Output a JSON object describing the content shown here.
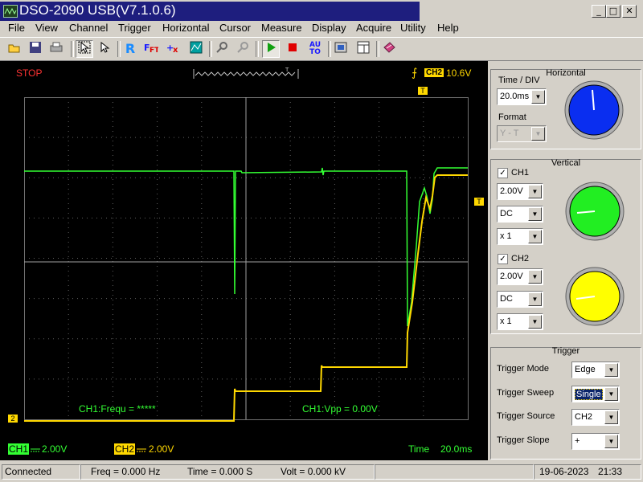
{
  "window": {
    "title": "DSO-2090 USB(V7.1.0.6)",
    "controls": [
      "_",
      "□",
      "✕"
    ]
  },
  "menu": [
    "File",
    "View",
    "Channel",
    "Trigger",
    "Horizontal",
    "Cursor",
    "Measure",
    "Display",
    "Acquire",
    "Utility",
    "Help"
  ],
  "toolbar": {
    "icons": [
      "open-icon",
      "save-icon",
      "print-icon",
      "pointer-select-icon",
      "pointer-icon",
      "reference-icon",
      "fft-icon",
      "math-icon",
      "waveform-zoom-icon",
      "zoom-in-icon",
      "zoom-out-icon",
      "run-icon",
      "stop-icon",
      "auto-set-icon",
      "screenshot-icon",
      "record-icon",
      "book-icon"
    ],
    "auto_label_top": "AU",
    "auto_label_bottom": "TO",
    "r_label": "R"
  },
  "scope": {
    "status": "STOP",
    "trigger_channel": "CH2",
    "trigger_level": "10.6V",
    "ch1_marker": "T",
    "ch2_marker": "2",
    "trigger_pos_marker": "T",
    "measure_freq": "CH1:Frequ = *****",
    "measure_vpp": "CH1:Vpp = 0.00V",
    "ch1_label": "CH1",
    "ch1_scale": "2.00V",
    "ch2_label": "CH2",
    "ch2_scale": "2.00V",
    "time_label": "Time",
    "time_value": "20.0ms",
    "colors": {
      "ch1": "#33ff33",
      "ch2": "#ffd800",
      "status": "#ff3333"
    }
  },
  "horizontal": {
    "title": "Horizontal",
    "time_div_label": "Time / DIV",
    "time_div_value": "20.0ms",
    "format_label": "Format",
    "format_value": "Y - T",
    "knob_color": "#0a2ef0"
  },
  "vertical": {
    "title": "Vertical",
    "ch1": {
      "label": "CH1",
      "checked": true,
      "volts": "2.00V",
      "coupling": "DC",
      "probe": "x 1",
      "knob_color": "#22ee22"
    },
    "ch2": {
      "label": "CH2",
      "checked": true,
      "volts": "2.00V",
      "coupling": "DC",
      "probe": "x 1",
      "knob_color": "#ffff00"
    }
  },
  "trigger": {
    "title": "Trigger",
    "mode_label": "Trigger Mode",
    "mode_value": "Edge",
    "sweep_label": "Trigger Sweep",
    "sweep_value": "Single",
    "source_label": "Trigger Source",
    "source_value": "CH2",
    "slope_label": "Trigger Slope",
    "slope_value": "+"
  },
  "statusbar": {
    "connection": "Connected",
    "freq": "Freq = 0.000 Hz",
    "time": "Time = 0.000 S",
    "volt": "Volt = 0.000 kV",
    "date": "19-06-2023",
    "clock": "21:33"
  }
}
